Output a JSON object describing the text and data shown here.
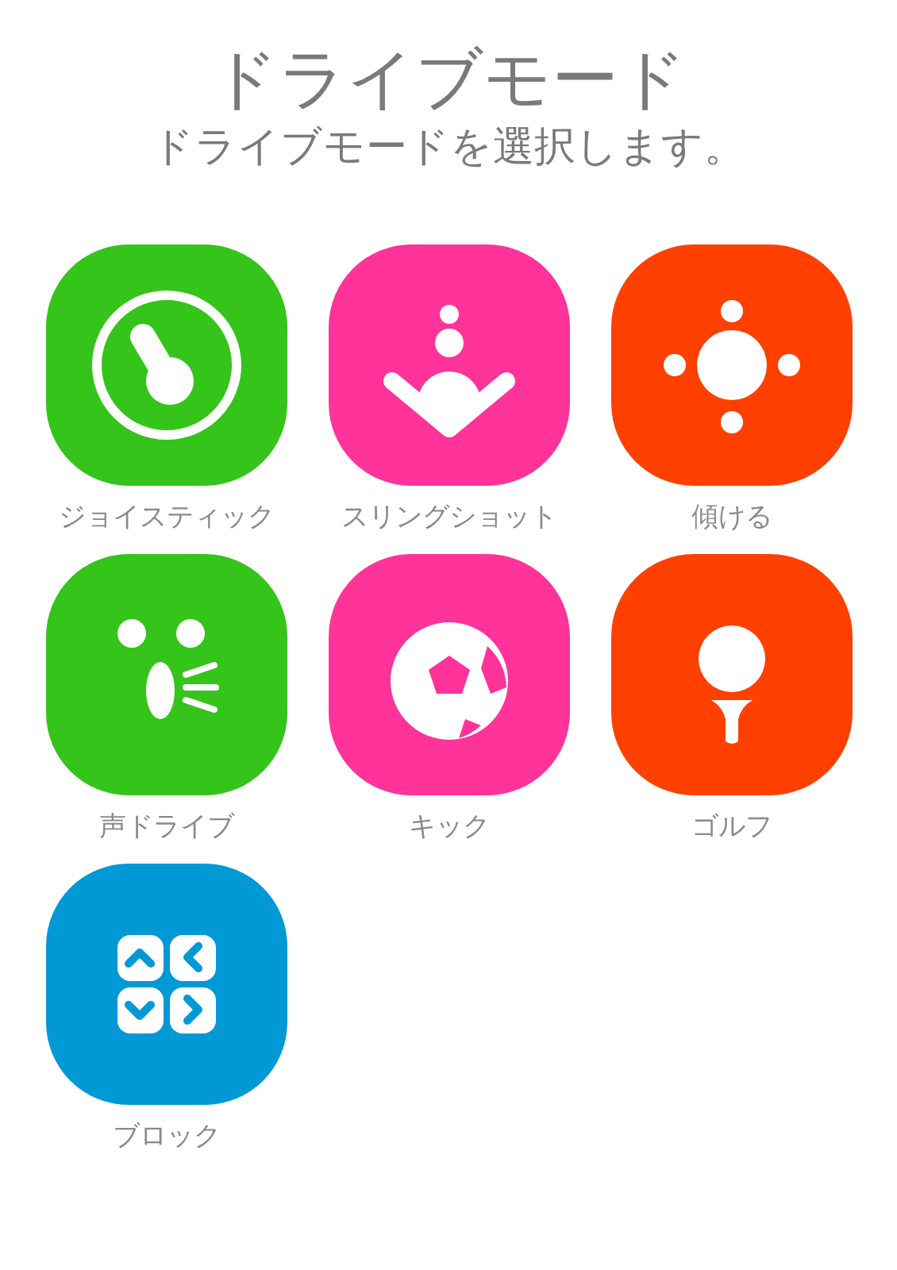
{
  "header": {
    "title": "ドライブモード",
    "subtitle": "ドライブモードを選択します。"
  },
  "modes": [
    {
      "label": "ジョイスティック",
      "kind": "joystick",
      "color": "#34c41a"
    },
    {
      "label": "スリングショット",
      "kind": "slingshot",
      "color": "#ff3399"
    },
    {
      "label": "傾ける",
      "kind": "tilt",
      "color": "#ff4000"
    },
    {
      "label": "声ドライブ",
      "kind": "voice",
      "color": "#34c41a"
    },
    {
      "label": "キック",
      "kind": "kick",
      "color": "#ff3399"
    },
    {
      "label": "ゴルフ",
      "kind": "golf",
      "color": "#ff4000"
    },
    {
      "label": "ブロック",
      "kind": "block",
      "color": "#0099d6"
    }
  ]
}
